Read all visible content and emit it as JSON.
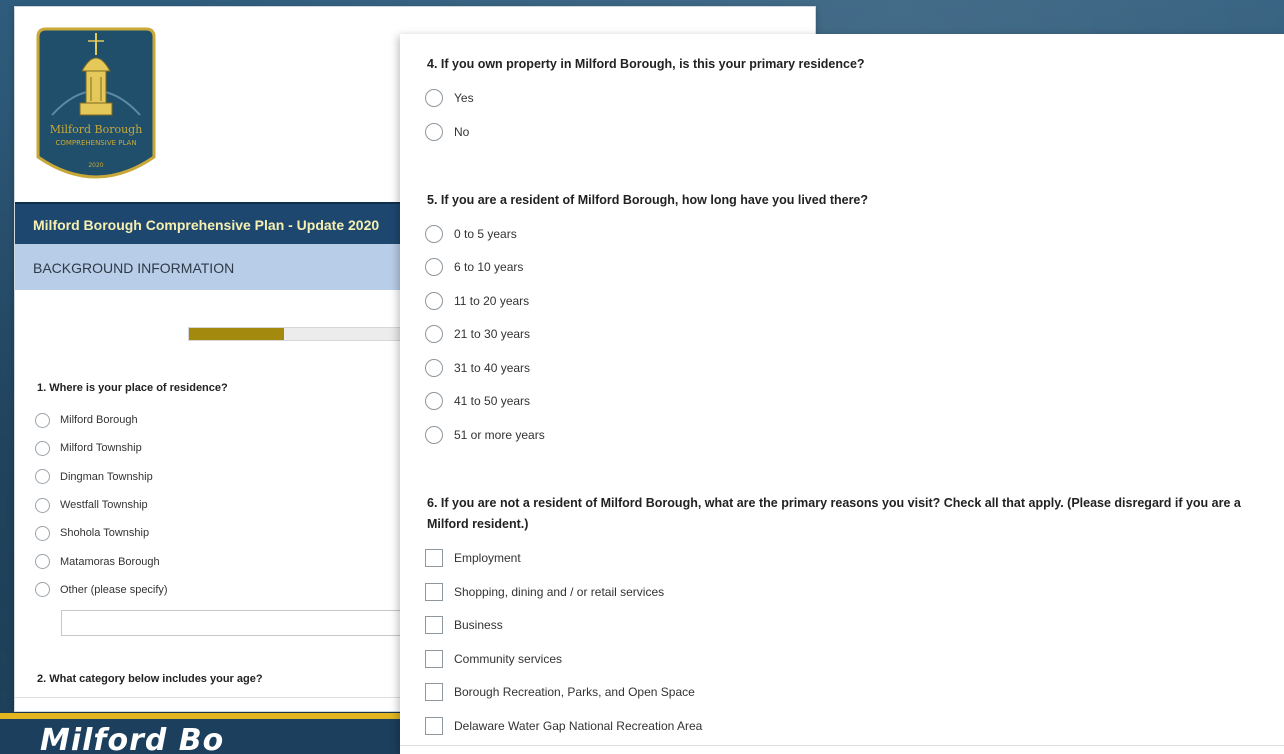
{
  "back_panel": {
    "logo": {
      "line1": "Milford Borough",
      "line2": "COMPREHENSIVE PLAN",
      "year": "2020"
    },
    "header_title": "Milford Borough Comprehensive Plan - Update 2020",
    "section_title": "BACKGROUND INFORMATION",
    "progress": 0.4,
    "q1": {
      "title": "1. Where is your place of residence?",
      "options": [
        "Milford Borough",
        "Milford Township",
        "Dingman Township",
        "Westfall Township",
        "Shohola Township",
        "Matamoras Borough",
        "Other (please specify)"
      ]
    },
    "q2_title": "2. What category below includes your age?"
  },
  "bottom_strip_text": "Milford Bo",
  "front_panel": {
    "q4": {
      "title": "4. If you own property in Milford Borough, is this your primary residence?",
      "options": [
        "Yes",
        "No"
      ]
    },
    "q5": {
      "title": "5. If you are a resident of Milford Borough, how long have you lived there?",
      "options": [
        "0 to 5 years",
        "6 to 10 years",
        "11 to 20 years",
        "21 to 30 years",
        "31 to 40 years",
        "41 to 50 years",
        "51 or more years"
      ]
    },
    "q6": {
      "title": "6. If you are not a resident of Milford Borough, what are the primary reasons you visit? Check all that apply. (Please disregard if you are a Milford resident.)",
      "options": [
        "Employment",
        "Shopping, dining and / or retail services",
        "Business",
        "Community services",
        "Borough Recreation, Parks, and Open Space",
        "Delaware Water Gap National Recreation Area"
      ]
    }
  },
  "colors": {
    "header_bg": "#1e4770",
    "header_text": "#f6f0b0",
    "section_bg": "#b8cde8",
    "progress_fill": "#a38a0f",
    "strip_gold": "#e2b521"
  }
}
